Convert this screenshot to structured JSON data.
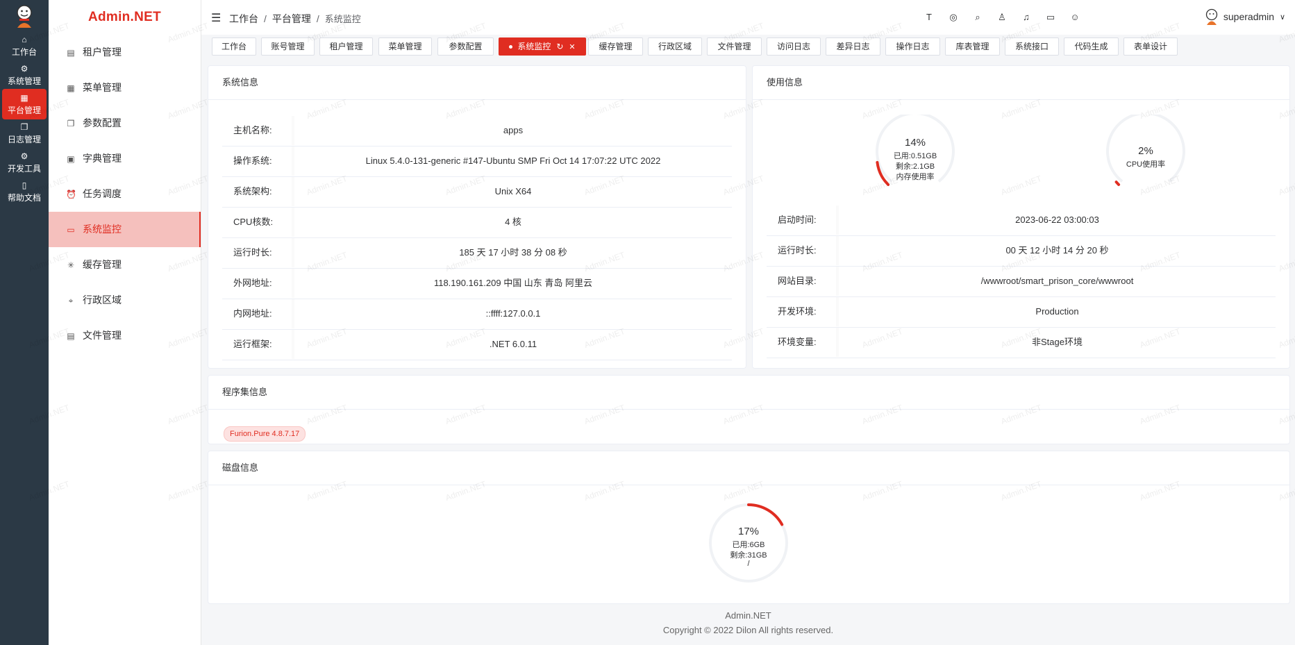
{
  "app": {
    "brand": "Admin.NET"
  },
  "rail": [
    {
      "label": "工作台",
      "icon": "home-icon"
    },
    {
      "label": "系统管理",
      "icon": "gear-icon"
    },
    {
      "label": "平台管理",
      "icon": "grid-icon",
      "active": true
    },
    {
      "label": "日志管理",
      "icon": "copy-icon"
    },
    {
      "label": "开发工具",
      "icon": "gear-icon"
    },
    {
      "label": "帮助文档",
      "icon": "book-icon"
    }
  ],
  "menu": [
    {
      "label": "租户管理",
      "icon": "tenant-icon"
    },
    {
      "label": "菜单管理",
      "icon": "menu-icon"
    },
    {
      "label": "参数配置",
      "icon": "param-icon"
    },
    {
      "label": "字典管理",
      "icon": "dict-icon"
    },
    {
      "label": "任务调度",
      "icon": "alarm-icon"
    },
    {
      "label": "系统监控",
      "icon": "monitor-icon",
      "active": true
    },
    {
      "label": "缓存管理",
      "icon": "loading-icon"
    },
    {
      "label": "行政区域",
      "icon": "location-icon"
    },
    {
      "label": "文件管理",
      "icon": "document-icon"
    }
  ],
  "breadcrumb": {
    "first": "工作台",
    "second": "平台管理",
    "current": "系统监控",
    "sep": "/"
  },
  "toolbar": {
    "icons": [
      "font-size-icon",
      "language-icon",
      "search-icon",
      "theme-icon",
      "bell-icon",
      "screen-icon",
      "user-icon"
    ],
    "username": "superadmin"
  },
  "tabs": [
    "工作台",
    "账号管理",
    "租户管理",
    "菜单管理",
    "参数配置",
    "系统监控",
    "缓存管理",
    "行政区域",
    "文件管理",
    "访问日志",
    "差异日志",
    "操作日志",
    "库表管理",
    "系统接口",
    "代码生成",
    "表单设计"
  ],
  "active_tab": "系统监控",
  "sysinfo": {
    "title": "系统信息",
    "rows": [
      {
        "k": "主机名称:",
        "v": "apps"
      },
      {
        "k": "操作系统:",
        "v": "Linux 5.4.0-131-generic #147-Ubuntu SMP Fri Oct 14 17:07:22 UTC 2022"
      },
      {
        "k": "系统架构:",
        "v": "Unix X64"
      },
      {
        "k": "CPU核数:",
        "v": "4 核"
      },
      {
        "k": "运行时长:",
        "v": "185 天 17 小时 38 分 08 秒"
      },
      {
        "k": "外网地址:",
        "v": "118.190.161.209 中国 山东 青岛 阿里云"
      },
      {
        "k": "内网地址:",
        "v": "::ffff:127.0.0.1"
      },
      {
        "k": "运行框架:",
        "v": ".NET 6.0.11"
      }
    ]
  },
  "usage": {
    "title": "使用信息",
    "memory": {
      "percent": "14%",
      "value": 14,
      "used": "已用:0.51GB",
      "free": "剩余:2.1GB",
      "label": "内存使用率"
    },
    "cpu": {
      "percent": "2%",
      "value": 2,
      "label": "CPU使用率"
    },
    "rows": [
      {
        "k": "启动时间:",
        "v": "2023-06-22 03:00:03"
      },
      {
        "k": "运行时长:",
        "v": "00 天 12 小时 14 分 20 秒"
      },
      {
        "k": "网站目录:",
        "v": "/wwwroot/smart_prison_core/wwwroot"
      },
      {
        "k": "开发环境:",
        "v": "Production"
      },
      {
        "k": "环境变量:",
        "v": "非Stage环境"
      }
    ]
  },
  "assembly": {
    "title": "程序集信息",
    "tags": [
      "Furion.Pure 4.8.7.17"
    ]
  },
  "disk": {
    "title": "磁盘信息",
    "percent": "17%",
    "value": 17,
    "used": "已用:6GB",
    "free": "剩余:31GB",
    "mount": "/"
  },
  "footer": {
    "line1": "Admin.NET",
    "line2": "Copyright © 2022 Dilon All rights reserved."
  },
  "colors": {
    "accent": "#e02d21",
    "rail": "#2b3945",
    "menu_active_bg": "#f5c0bd",
    "track": "#f0f2f5"
  },
  "watermark": "Admin.NET"
}
